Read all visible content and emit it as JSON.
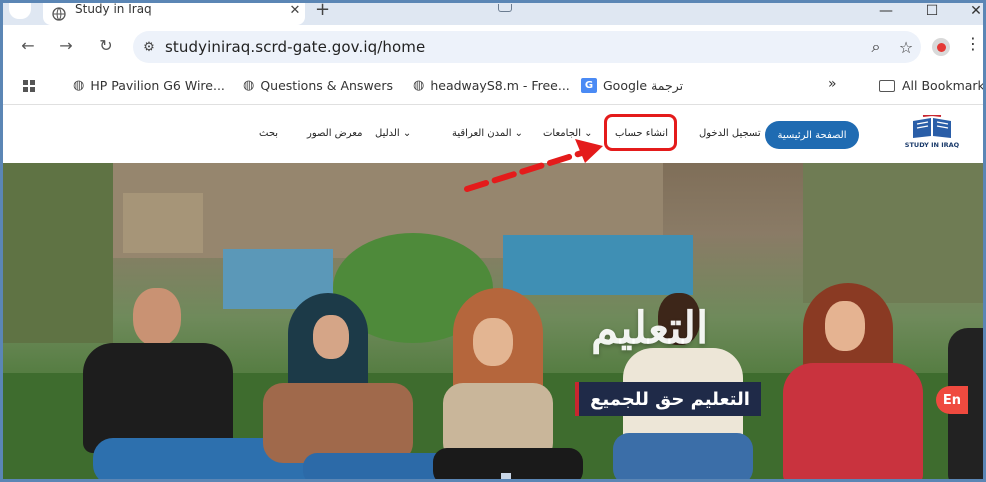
{
  "browser": {
    "tab_title": "Study in Iraq",
    "tab_close": "✕",
    "new_tab": "+",
    "url": "studyiniraq.scrd-gate.gov.iq/home",
    "window_minimize": "—",
    "window_maximize": "☐",
    "window_close": "✕"
  },
  "bookmarks": [
    {
      "label": "HP Pavilion G6 Wire...",
      "icon": "globe-icon"
    },
    {
      "label": "Questions & Answers",
      "icon": "globe-icon"
    },
    {
      "label": "headwayS8.m - Free...",
      "icon": "globe-icon"
    },
    {
      "label": "Google ترجمة",
      "icon": "google-translate-icon"
    },
    {
      "label": "»",
      "icon": "overflow-icon"
    },
    {
      "label": "All Bookmarks",
      "icon": "folder-icon"
    }
  ],
  "site": {
    "logo_text": "STUDY IN IRAQ",
    "nav": {
      "home": "الصفحة الرئيسية",
      "login": "تسجيل الدخول",
      "create_account": "انشاء حساب",
      "universities": "الجامعات",
      "iraqi_cities": "المدن العراقية",
      "guide": "الدليل",
      "gallery": "معرض الصور",
      "search": "بحث"
    }
  },
  "hero": {
    "title": "التعليم",
    "subtitle": "التعليم حق للجميع",
    "language_button": "En"
  },
  "colors": {
    "home_button": "#1f6bb2",
    "highlight": "#e41b1b",
    "banner": "#1f2a48",
    "language_button": "#ef4a3f"
  }
}
